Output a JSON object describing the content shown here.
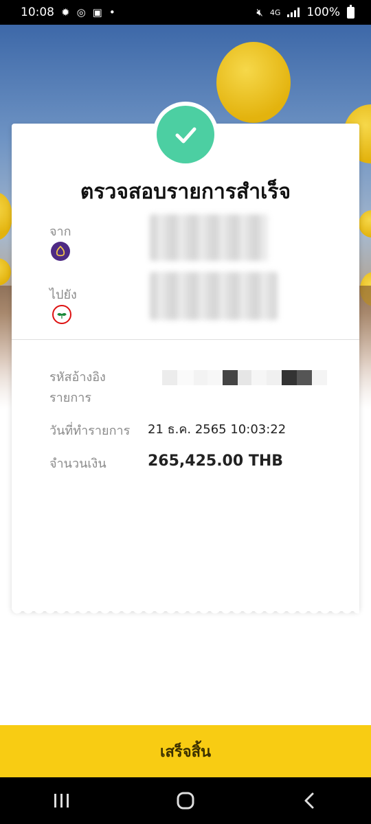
{
  "status_bar": {
    "time": "10:08",
    "network": "4G",
    "battery": "100%"
  },
  "card": {
    "title": "ตรวจสอบรายการสำเร็จ",
    "from_label": "จาก",
    "from_bank_icon": "scb-bank-icon",
    "to_label": "ไปยัง",
    "to_bank_icon": "kbank-bank-icon",
    "reference_label_line1": "รหัสอ้างอิง",
    "reference_label_line2": "รายการ",
    "date_label": "วันที่ทำรายการ",
    "date_value": "21 ธ.ค. 2565 10:03:22",
    "amount_label": "จำนวนเงิน",
    "amount_value": "265,425.00 THB"
  },
  "footer": {
    "done_label": "เสร็จสิ้น"
  },
  "colors": {
    "success": "#4ccfa2",
    "button": "#f8cc13",
    "scb": "#4e2a84",
    "kbank": "#1a8a3a"
  }
}
